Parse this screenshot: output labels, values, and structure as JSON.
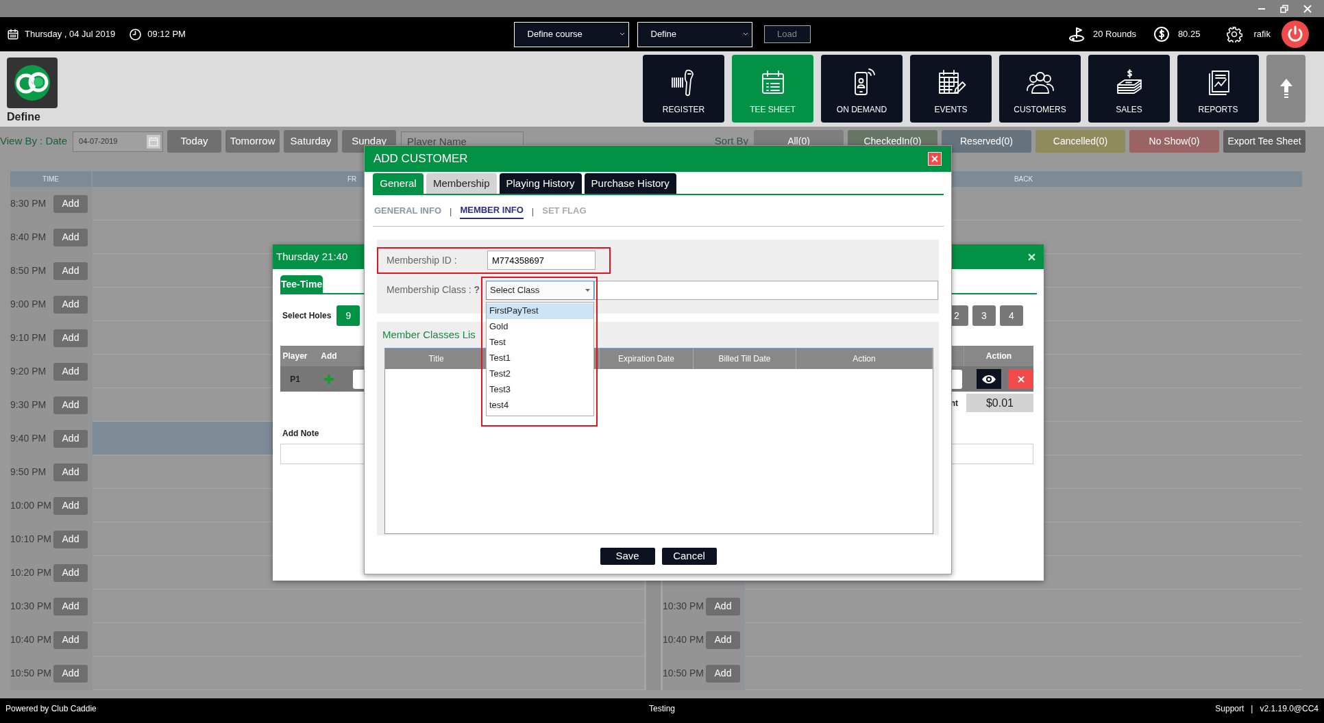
{
  "top_bar": {
    "date": "Thursday , 04 Jul 2019",
    "time": "09:12 PM",
    "course_select": {
      "value": "Define course"
    },
    "define_select": {
      "value": "Define"
    },
    "load_button": {
      "label": "Load",
      "disabled": true
    },
    "rounds": "20 Rounds",
    "balance": "80.25",
    "user": "rafik"
  },
  "brand": {
    "name": "Define"
  },
  "nav_tiles": [
    {
      "label": "REGISTER",
      "selected": false
    },
    {
      "label": "TEE SHEET",
      "selected": true
    },
    {
      "label": "ON DEMAND",
      "selected": false
    },
    {
      "label": "EVENTS",
      "selected": false
    },
    {
      "label": "CUSTOMERS",
      "selected": false
    },
    {
      "label": "SALES",
      "selected": false
    },
    {
      "label": "REPORTS",
      "selected": false
    }
  ],
  "filter_bar": {
    "view_by": "View By : Date",
    "date": {
      "value": "04-07-2019"
    },
    "day_buttons": [
      "Today",
      "Tomorrow",
      "Saturday",
      "Sunday"
    ],
    "player_search": {
      "placeholder": "Player Name"
    },
    "sort_by": "Sort By",
    "status_filters": [
      {
        "label": "All(0)",
        "color": "#7e7e7e"
      },
      {
        "label": "CheckedIn(0)",
        "color": "#677567"
      },
      {
        "label": "Reserved(0)",
        "color": "#67747e"
      },
      {
        "label": "Cancelled(0)",
        "color": "#8f8b5c"
      },
      {
        "label": "No Show(0)",
        "color": "#996463"
      }
    ],
    "export_button": "Export Tee Sheet"
  },
  "tee_sheet": {
    "columns": [
      "TIME",
      "FR",
      "BACK"
    ],
    "front_rows": [
      {
        "time": "8:30 PM",
        "button": "Add",
        "selected": false
      },
      {
        "time": "8:40 PM",
        "button": "Add",
        "selected": false
      },
      {
        "time": "8:50 PM",
        "button": "Add",
        "selected": false
      },
      {
        "time": "9:00 PM",
        "button": "Add",
        "selected": false
      },
      {
        "time": "9:10 PM",
        "button": "Add",
        "selected": false
      },
      {
        "time": "9:20 PM",
        "button": "Add",
        "selected": false
      },
      {
        "time": "9:30 PM",
        "button": "Add",
        "selected": false
      },
      {
        "time": "9:40 PM",
        "button": "Add",
        "selected": true
      },
      {
        "time": "9:50 PM",
        "button": "Add",
        "selected": false
      },
      {
        "time": "10:00 PM",
        "button": "Add",
        "selected": false
      },
      {
        "time": "10:10 PM",
        "button": "Add",
        "selected": false
      },
      {
        "time": "10:20 PM",
        "button": "Add",
        "selected": false
      },
      {
        "time": "10:30 PM",
        "button": "Add",
        "selected": false
      },
      {
        "time": "10:40 PM",
        "button": "Add",
        "selected": false
      },
      {
        "time": "10:50 PM",
        "button": "Add",
        "selected": false
      }
    ],
    "back_rows": [
      {
        "time": "10:30 PM",
        "button": "Add"
      },
      {
        "time": "10:40 PM",
        "button": "Add"
      },
      {
        "time": "10:50 PM",
        "button": "Add"
      }
    ]
  },
  "tee_time_dialog": {
    "title": "Thursday 21:40",
    "tabs": [
      {
        "label": "Tee-Time",
        "selected": true
      }
    ],
    "holes_label": "Select Holes",
    "holes": [
      {
        "label": "9",
        "selected": true
      }
    ],
    "player_counts": [
      "2",
      "3",
      "4"
    ],
    "players_table": {
      "columns": [
        "Player",
        "Add",
        "Action"
      ],
      "rows": [
        {
          "player": "P1"
        }
      ]
    },
    "amount_label": "nt",
    "amount": "$0.01",
    "note_label": "Add Note"
  },
  "add_customer_dialog": {
    "title": "ADD CUSTOMER",
    "tabs": [
      {
        "label": "General",
        "selected": true,
        "kind": "light"
      },
      {
        "label": "Membership",
        "selected": false,
        "kind": "light"
      },
      {
        "label": "Playing History",
        "selected": false,
        "kind": "dark"
      },
      {
        "label": "Purchase History",
        "selected": false,
        "kind": "dark"
      }
    ],
    "sub_tabs": [
      {
        "label": "GENERAL INFO",
        "selected": false,
        "disabled": false
      },
      {
        "label": "MEMBER INFO",
        "selected": true,
        "disabled": false
      },
      {
        "label": "SET FLAG",
        "selected": false,
        "disabled": true
      }
    ],
    "sub_tab_separators": [
      "|",
      "|"
    ],
    "membership_id": {
      "label": "Membership ID :",
      "value": "M774358697",
      "highlighted": true
    },
    "membership_class": {
      "label": "Membership Class : **?**",
      "value": "Select Class",
      "highlighted": true,
      "expanded": true,
      "options": [
        {
          "label": "FirstPayTest",
          "selected": true
        },
        {
          "label": "Gold",
          "selected": false
        },
        {
          "label": "Test",
          "selected": false
        },
        {
          "label": "Test1",
          "selected": false
        },
        {
          "label": "Test2",
          "selected": false
        },
        {
          "label": "Test3",
          "selected": false
        },
        {
          "label": "test4",
          "selected": false
        }
      ]
    },
    "member_classes": {
      "title": "Member Classes Lis",
      "columns": [
        "Title",
        "Expiration Date",
        "Billed Till Date",
        "Action"
      ]
    },
    "buttons": [
      "Save",
      "Cancel"
    ]
  },
  "footer": {
    "powered_by": "Powered by Club Caddie",
    "environment": "Testing",
    "support_link": "Support",
    "separator": "|",
    "version": "v2.1.19.0@CC4"
  }
}
